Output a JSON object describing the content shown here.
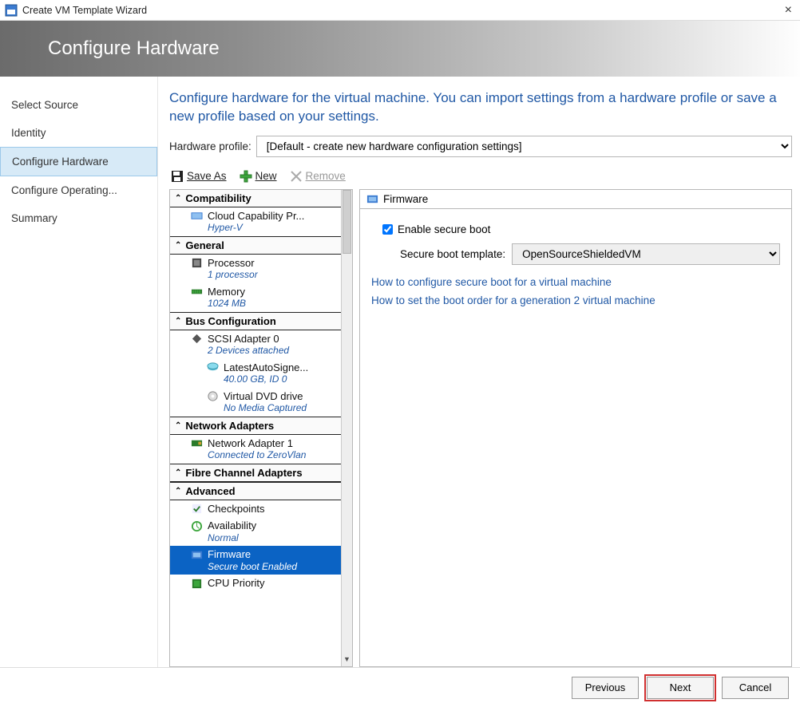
{
  "window": {
    "title": "Create VM Template Wizard",
    "close_label": "×"
  },
  "banner": {
    "title": "Configure Hardware"
  },
  "steps": {
    "items": [
      {
        "label": "Select Source"
      },
      {
        "label": "Identity"
      },
      {
        "label": "Configure Hardware",
        "selected": true
      },
      {
        "label": "Configure Operating..."
      },
      {
        "label": "Summary"
      }
    ]
  },
  "intro": "Configure hardware for the virtual machine. You can import settings from a hardware profile or save a new profile based on your settings.",
  "profile": {
    "label": "Hardware profile:",
    "value": "[Default - create new hardware configuration settings]"
  },
  "toolbar": {
    "save_as": "Save As",
    "new": "New",
    "remove": "Remove"
  },
  "tree": {
    "groups": [
      {
        "label": "Compatibility",
        "items": [
          {
            "name": "Cloud Capability Pr...",
            "sub": "Hyper-V",
            "icon": "cloud"
          }
        ]
      },
      {
        "label": "General",
        "items": [
          {
            "name": "Processor",
            "sub": "1 processor",
            "icon": "cpu"
          },
          {
            "name": "Memory",
            "sub": "1024 MB",
            "icon": "memory"
          }
        ]
      },
      {
        "label": "Bus Configuration",
        "items": [
          {
            "name": "SCSI Adapter 0",
            "sub": "2 Devices attached",
            "icon": "scsi",
            "children": [
              {
                "name": "LatestAutoSigne...",
                "sub": "40.00 GB, ID 0",
                "icon": "disk"
              },
              {
                "name": "Virtual DVD drive",
                "sub": "No Media Captured",
                "icon": "dvd"
              }
            ]
          }
        ]
      },
      {
        "label": "Network Adapters",
        "items": [
          {
            "name": "Network Adapter 1",
            "sub": "Connected to ZeroVlan",
            "icon": "nic"
          }
        ]
      },
      {
        "label": "Fibre Channel Adapters",
        "items": []
      },
      {
        "label": "Advanced",
        "items": [
          {
            "name": "Checkpoints",
            "sub": "",
            "icon": "checkpoint"
          },
          {
            "name": "Availability",
            "sub": "Normal",
            "icon": "avail"
          },
          {
            "name": "Firmware",
            "sub": "Secure boot Enabled",
            "icon": "firmware",
            "selected": true
          },
          {
            "name": "CPU Priority",
            "sub": "",
            "icon": "cpupri"
          }
        ]
      }
    ]
  },
  "detail": {
    "title": "Firmware",
    "enable_label": "Enable secure boot",
    "enable_checked": true,
    "template_label": "Secure boot template:",
    "template_value": "OpenSourceShieldedVM",
    "link1": "How to configure secure boot for a virtual machine",
    "link2": "How to set the boot order for a generation 2 virtual machine"
  },
  "footer": {
    "previous": "Previous",
    "next": "Next",
    "cancel": "Cancel"
  }
}
